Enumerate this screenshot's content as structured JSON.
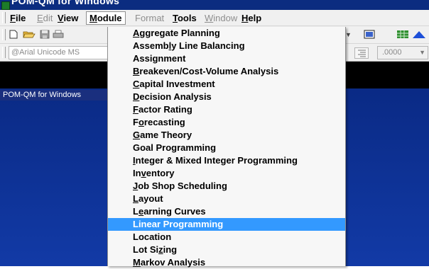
{
  "window": {
    "title": "POM-QM for Windows"
  },
  "menubar": {
    "items": [
      {
        "label": "File",
        "accel": "F",
        "rest": "ile",
        "enabled": true
      },
      {
        "label": "Edit",
        "accel": "E",
        "rest": "dit",
        "enabled": false
      },
      {
        "label": "View",
        "accel": "V",
        "rest": "iew",
        "enabled": true
      },
      {
        "label": "Module",
        "accel": "M",
        "rest": "odule",
        "enabled": true,
        "open": true
      },
      {
        "label": "Format",
        "accel": "",
        "rest": "Format",
        "enabled": false
      },
      {
        "label": "Tools",
        "accel": "T",
        "rest": "ools",
        "enabled": true
      },
      {
        "label": "Window",
        "accel": "W",
        "rest": "indow",
        "enabled": false
      },
      {
        "label": "Help",
        "accel": "H",
        "rest": "elp",
        "enabled": true
      }
    ]
  },
  "toolbar2": {
    "font_name": "@Arial Unicode MS",
    "number_format": ".0000"
  },
  "child_window": {
    "title": "POM-QM for Windows"
  },
  "module_menu": {
    "items": [
      {
        "label": "Aggregate Planning",
        "before": "",
        "accel": "A",
        "after": "ggregate Planning"
      },
      {
        "label": "Assembly Line Balancing",
        "before": "Assemb",
        "accel": "l",
        "after": "y Line Balancing"
      },
      {
        "label": "Assignment",
        "before": "Assignment",
        "accel": "",
        "after": ""
      },
      {
        "label": "Breakeven/Cost-Volume Analysis",
        "before": "",
        "accel": "B",
        "after": "reakeven/Cost-Volume Analysis"
      },
      {
        "label": "Capital Investment",
        "before": "",
        "accel": "C",
        "after": "apital Investment"
      },
      {
        "label": "Decision Analysis",
        "before": "",
        "accel": "D",
        "after": "ecision Analysis"
      },
      {
        "label": "Factor Rating",
        "before": "",
        "accel": "F",
        "after": "actor Rating"
      },
      {
        "label": "Forecasting",
        "before": "F",
        "accel": "o",
        "after": "recasting"
      },
      {
        "label": "Game Theory",
        "before": "",
        "accel": "G",
        "after": "ame Theory"
      },
      {
        "label": "Goal Programming",
        "before": "Goal Programming",
        "accel": "",
        "after": ""
      },
      {
        "label": "Integer & Mixed Integer Programming",
        "before": "",
        "accel": "I",
        "after": "nteger & Mixed Integer Programming"
      },
      {
        "label": "Inventory",
        "before": "In",
        "accel": "v",
        "after": "entory"
      },
      {
        "label": "Job Shop Scheduling",
        "before": "",
        "accel": "J",
        "after": "ob Shop Scheduling"
      },
      {
        "label": "Layout",
        "before": "",
        "accel": "L",
        "after": "ayout"
      },
      {
        "label": "Learning Curves",
        "before": "L",
        "accel": "e",
        "after": "arning Curves"
      },
      {
        "label": "Linear Programming",
        "before": "Linear Programming",
        "accel": "",
        "after": "",
        "selected": true
      },
      {
        "label": "Location",
        "before": "Location",
        "accel": "",
        "after": ""
      },
      {
        "label": "Lot Sizing",
        "before": "Lot Si",
        "accel": "z",
        "after": "ing"
      },
      {
        "label": "Markov Analysis",
        "before": "",
        "accel": "M",
        "after": "arkov Analysis"
      }
    ]
  },
  "colors": {
    "titlebar": "#0b2c80",
    "selection": "#3399ff",
    "workspace": "#123aa6",
    "menu_bg": "#f7f7f7"
  },
  "icons": [
    "app-icon",
    "new-file-icon",
    "open-folder-icon",
    "save-icon",
    "print-icon",
    "spreadsheet-icon",
    "grid-icon",
    "chart-icon",
    "align-right-icon"
  ]
}
